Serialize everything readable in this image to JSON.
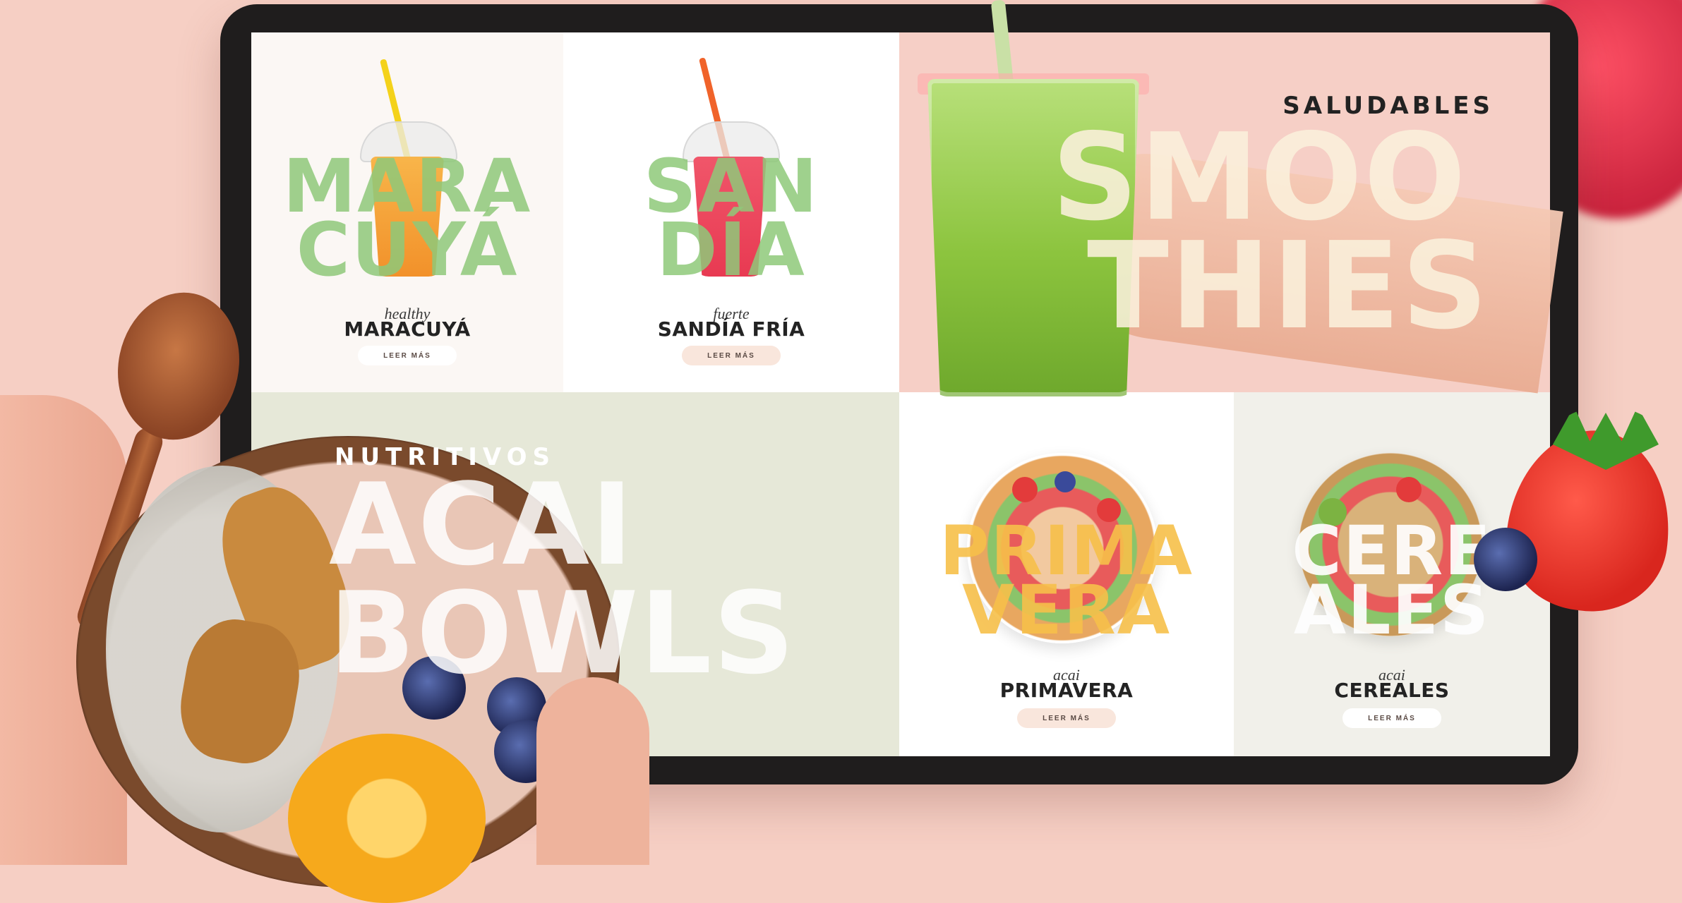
{
  "tiles": {
    "maracuya": {
      "big_line1": "MARA",
      "big_line2": "CUYÁ",
      "tag": "healthy",
      "name": "MARACUYÁ",
      "button": "LEER MÁS"
    },
    "sandia": {
      "big_line1": "SAN",
      "big_line2": "DÍA",
      "tag": "fuerte",
      "name": "SANDÍA FRÍA",
      "button": "LEER MÁS"
    },
    "smoothies": {
      "kicker": "SALUDABLES",
      "big_line1": "SMOO",
      "big_line2": "THIES"
    },
    "acai": {
      "kicker": "NUTRITIVOS",
      "big_line1": "ACAI",
      "big_line2": "BOWLS"
    },
    "primavera": {
      "big_line1": "PRIMA",
      "big_line2": "VERA",
      "tag": "acai",
      "name": "PRIMAVERA",
      "button": "LEER MÁS"
    },
    "cereales": {
      "big_line1": "CERE",
      "big_line2": "ALES",
      "tag": "acai",
      "name": "CEREALES",
      "button": "LEER MÁS"
    }
  },
  "colors": {
    "background": "#f6cfc4",
    "frame": "#1f1d1d",
    "green_type": "#8fc97a",
    "yellow_type": "#f7c04a",
    "cream_type": "#fbf1dc"
  }
}
